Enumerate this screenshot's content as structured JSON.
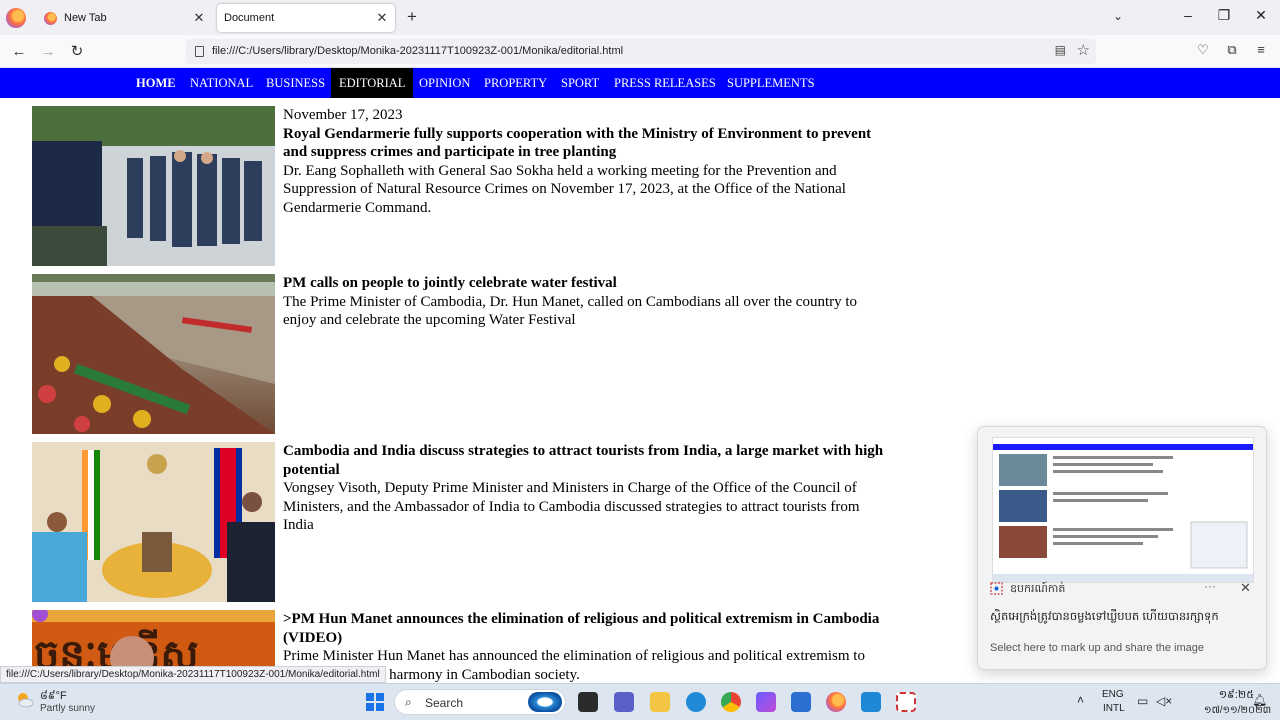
{
  "browser": {
    "tabs": [
      {
        "title": "New Tab",
        "active": false
      },
      {
        "title": "Document",
        "active": true
      }
    ],
    "url": "file:///C:/Users/library/Desktop/Monika-20231117T100923Z-001/Monika/editorial.html",
    "status_link": "file:///C:/Users/library/Desktop/Monika-20231117T100923Z-001/Monika/editorial.html"
  },
  "site_nav": {
    "items": [
      "HOME",
      "NATIONAL",
      "BUSINESS",
      "EDITORIAL",
      "OPINION",
      "PROPERTY",
      "SPORT",
      "PRESS RELEASES",
      "SUPPLEMENTS"
    ],
    "active": "EDITORIAL"
  },
  "articles": [
    {
      "date": "November 17, 2023",
      "headline": "Royal Gendarmerie fully supports cooperation with the Ministry of Environment to prevent and suppress crimes and participate in tree planting",
      "summary": "Dr. Eang Sophalleth with General Sao Sokha held a working meeting for the Prevention and Suppression of Natural Resource Crimes on November 17, 2023, at the Office of the National Gendarmerie Command."
    },
    {
      "date": "",
      "headline": "PM calls on people to jointly celebrate water festival",
      "summary": "The Prime Minister of Cambodia, Dr. Hun Manet, called on Cambodians all over the country to enjoy and celebrate the upcoming Water Festival"
    },
    {
      "date": "",
      "headline": "Cambodia and India discuss strategies to attract tourists from India, a large market with high potential",
      "summary": "Vongsey Visoth, Deputy Prime Minister and Ministers in Charge of the Office of the Council of Ministers, and the Ambassador of India to Cambodia discussed strategies to attract tourists from India"
    },
    {
      "date": "",
      "headline": ">PM Hun Manet announces the elimination of religious and political extremism in Cambodia (VIDEO)",
      "summary": "Prime Minister Hun Manet has announced the elimination of religious and political extremism to ensure peace and harmony in Cambodian society."
    }
  ],
  "snip_toast": {
    "app_name": "ឧបករណ៍កាត់",
    "message": "ស្ថិតអេក្រង់ត្រូវបានចម្លងទៅឃ្លីបបត ហើយបានរក្សាទុក",
    "hint": "Select here to mark up and share the image"
  },
  "taskbar": {
    "weather_temp": "៨៩°F",
    "weather_desc": "Partly sunny",
    "search_label": "Search",
    "lang_top": "ENG",
    "lang_bottom": "INTL",
    "time": "១៩:២៥",
    "date": "១៧/១១/២០២៣"
  },
  "colors": {
    "site_nav_bg": "#0000ff",
    "site_nav_active_bg": "#000000"
  }
}
